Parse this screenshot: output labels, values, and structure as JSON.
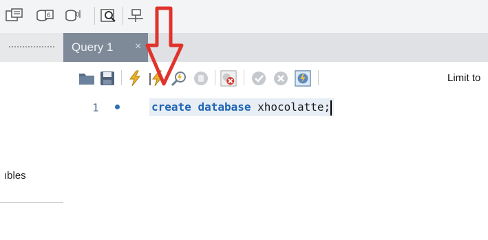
{
  "tab": {
    "label": "Query 1",
    "close": "×"
  },
  "toolbar": {
    "limit_label": "Limit to"
  },
  "navigator": {
    "partial_label": "ıbles"
  },
  "editor": {
    "line_number": "1",
    "kw_create": "create",
    "kw_database": "database",
    "identifier": "xhocolatte;"
  },
  "colors": {
    "keyword": "#1e64b4",
    "tab_active": "#7e8a98",
    "annotation_arrow": "#e0332b"
  },
  "icons": [
    "sql-file-icon",
    "new-schema-icon",
    "new-table-icon",
    "inspector-icon",
    "reconnect-icon",
    "open-file-icon",
    "save-icon",
    "execute-icon",
    "execute-current-icon",
    "explain-icon",
    "stop-icon",
    "toggle-error-icon",
    "commit-icon",
    "rollback-icon",
    "autocommit-icon"
  ]
}
